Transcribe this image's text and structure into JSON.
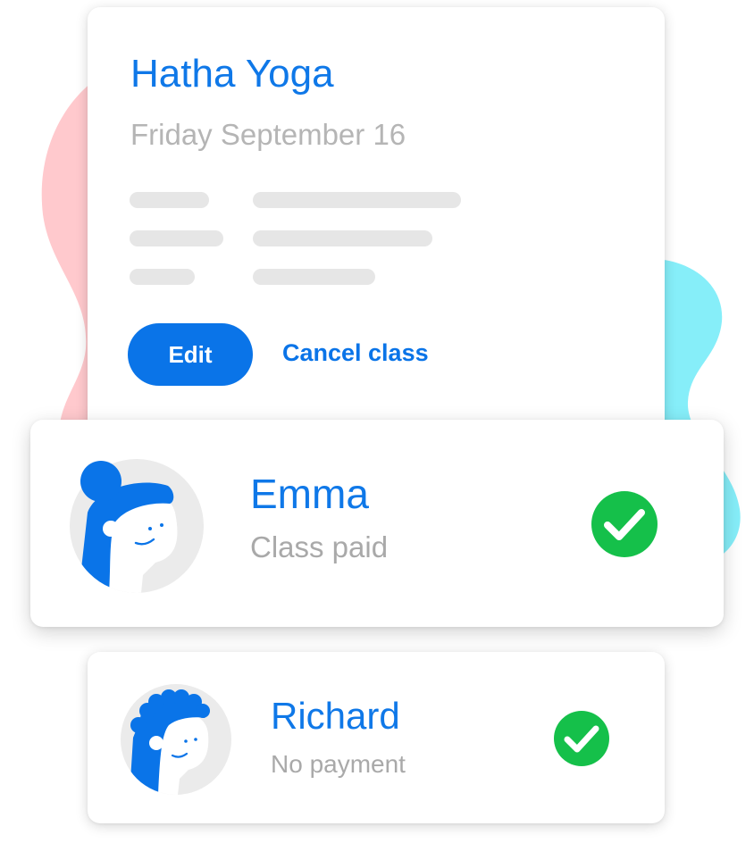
{
  "class": {
    "title": "Hatha Yoga",
    "date": "Friday September 16",
    "edit_label": "Edit",
    "cancel_label": "Cancel class"
  },
  "attendees": [
    {
      "name": "Emma",
      "status": "Class paid",
      "status_icon": "check-circle-icon"
    },
    {
      "name": "Richard",
      "status": "No payment",
      "status_icon": "check-circle-icon"
    }
  ],
  "colors": {
    "accent": "#0a74e8",
    "text_muted": "#b5b5b5",
    "success": "#15c04a",
    "blob_pink": "#ffc9cd",
    "blob_cyan": "#86eef9"
  }
}
